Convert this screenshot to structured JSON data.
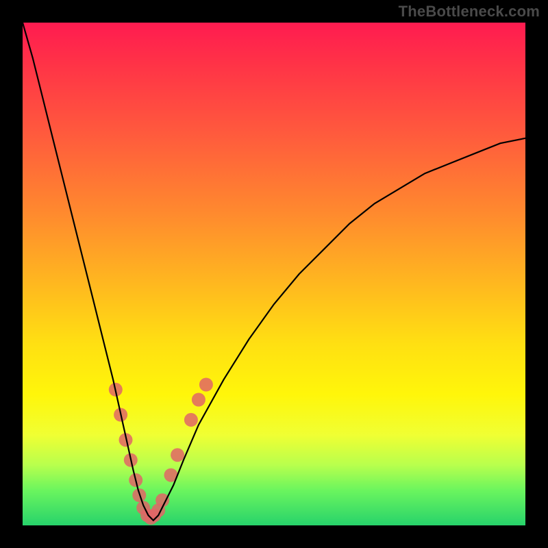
{
  "watermark": "TheBottleneck.com",
  "chart_data": {
    "type": "line",
    "title": "",
    "xlabel": "",
    "ylabel": "",
    "xlim": [
      0,
      100
    ],
    "ylim": [
      0,
      100
    ],
    "gradient_stops": [
      {
        "pos": 0,
        "color": "#ff1b50"
      },
      {
        "pos": 8,
        "color": "#ff3247"
      },
      {
        "pos": 22,
        "color": "#ff5a3d"
      },
      {
        "pos": 38,
        "color": "#ff8a2e"
      },
      {
        "pos": 52,
        "color": "#ffb81f"
      },
      {
        "pos": 64,
        "color": "#ffe012"
      },
      {
        "pos": 74,
        "color": "#fff60a"
      },
      {
        "pos": 82,
        "color": "#f0ff33"
      },
      {
        "pos": 88,
        "color": "#b8ff4d"
      },
      {
        "pos": 93,
        "color": "#6bf55e"
      },
      {
        "pos": 100,
        "color": "#27d36b"
      }
    ],
    "series": [
      {
        "name": "bottleneck-curve",
        "x": [
          0,
          2,
          4,
          6,
          8,
          10,
          12,
          14,
          16,
          18,
          20,
          22,
          23,
          24,
          25,
          26,
          27,
          28,
          30,
          32,
          35,
          40,
          45,
          50,
          55,
          60,
          65,
          70,
          75,
          80,
          85,
          90,
          95,
          100
        ],
        "y": [
          100,
          93,
          85,
          77,
          69,
          61,
          53,
          45,
          37,
          29,
          20,
          11,
          7,
          4,
          2,
          1,
          2,
          4,
          8,
          13,
          20,
          29,
          37,
          44,
          50,
          55,
          60,
          64,
          67,
          70,
          72,
          74,
          76,
          77
        ]
      }
    ],
    "scatter": {
      "name": "highlighted-points",
      "color": "#e06666",
      "radius": 10,
      "points": [
        {
          "x": 18.5,
          "y": 27
        },
        {
          "x": 19.5,
          "y": 22
        },
        {
          "x": 20.5,
          "y": 17
        },
        {
          "x": 21.5,
          "y": 13
        },
        {
          "x": 22.5,
          "y": 9
        },
        {
          "x": 23.2,
          "y": 6
        },
        {
          "x": 24.0,
          "y": 3.5
        },
        {
          "x": 24.8,
          "y": 2
        },
        {
          "x": 25.5,
          "y": 1.5
        },
        {
          "x": 26.2,
          "y": 2
        },
        {
          "x": 27.0,
          "y": 3
        },
        {
          "x": 27.8,
          "y": 5
        },
        {
          "x": 29.5,
          "y": 10
        },
        {
          "x": 30.8,
          "y": 14
        },
        {
          "x": 33.5,
          "y": 21
        },
        {
          "x": 35.0,
          "y": 25
        },
        {
          "x": 36.5,
          "y": 28
        }
      ]
    }
  }
}
